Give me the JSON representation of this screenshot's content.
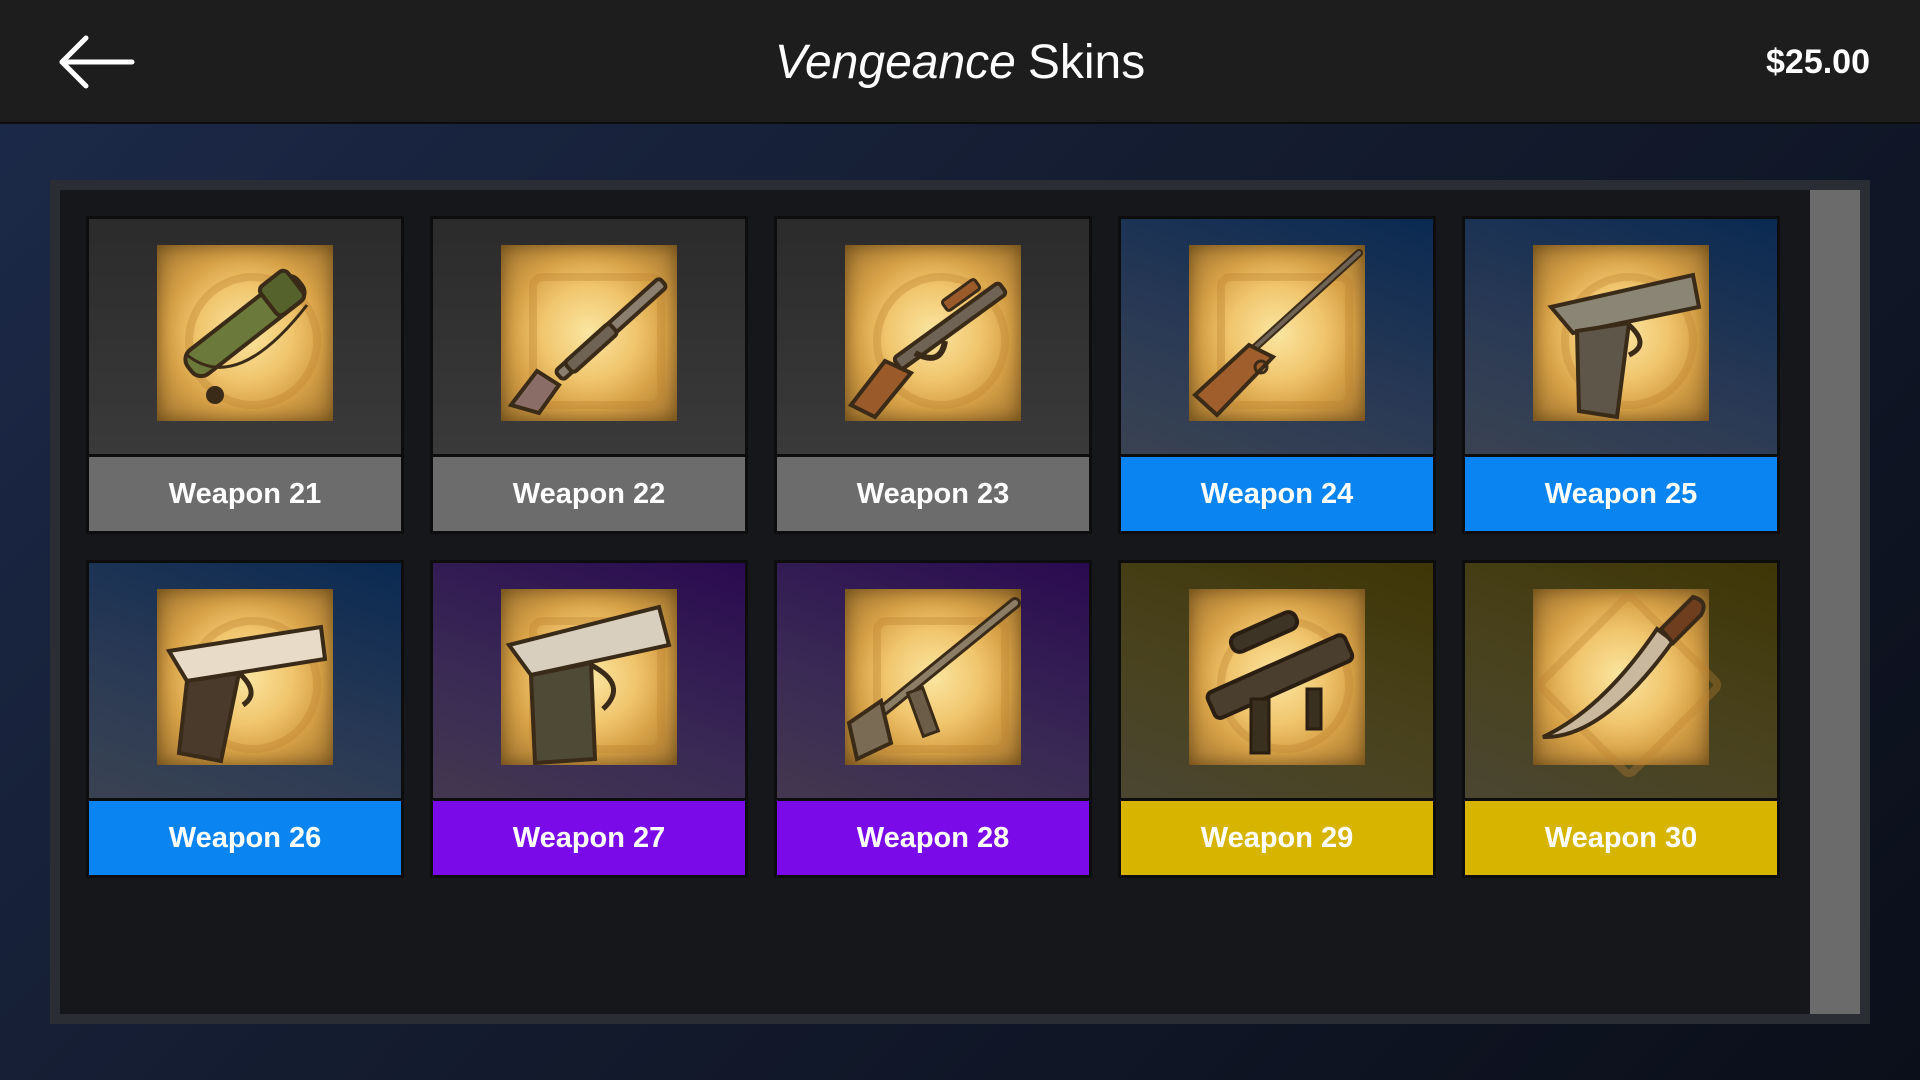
{
  "header": {
    "title_emphasis": "Vengeance",
    "title_rest": "Skins",
    "balance": "$25.00",
    "back_icon": "arrow-left-icon"
  },
  "colors": {
    "common": "#6c6c6c",
    "rare": "#0a84f0",
    "epic": "#7b0ae8",
    "legendary": "#d6b400"
  },
  "skins": [
    {
      "label": "Weapon 21",
      "rarity": "common",
      "icon": "rocket-launcher-icon"
    },
    {
      "label": "Weapon 22",
      "rarity": "common",
      "icon": "shotgun-icon"
    },
    {
      "label": "Weapon 23",
      "rarity": "common",
      "icon": "assault-rifle-icon"
    },
    {
      "label": "Weapon 24",
      "rarity": "rare",
      "icon": "hunting-rifle-icon"
    },
    {
      "label": "Weapon 25",
      "rarity": "rare",
      "icon": "desert-eagle-icon"
    },
    {
      "label": "Weapon 26",
      "rarity": "rare",
      "icon": "pistol-icon"
    },
    {
      "label": "Weapon 27",
      "rarity": "epic",
      "icon": "compact-pistol-icon"
    },
    {
      "label": "Weapon 28",
      "rarity": "epic",
      "icon": "m16-rifle-icon"
    },
    {
      "label": "Weapon 29",
      "rarity": "legendary",
      "icon": "smg-scoped-icon"
    },
    {
      "label": "Weapon 30",
      "rarity": "legendary",
      "icon": "machete-icon"
    }
  ]
}
